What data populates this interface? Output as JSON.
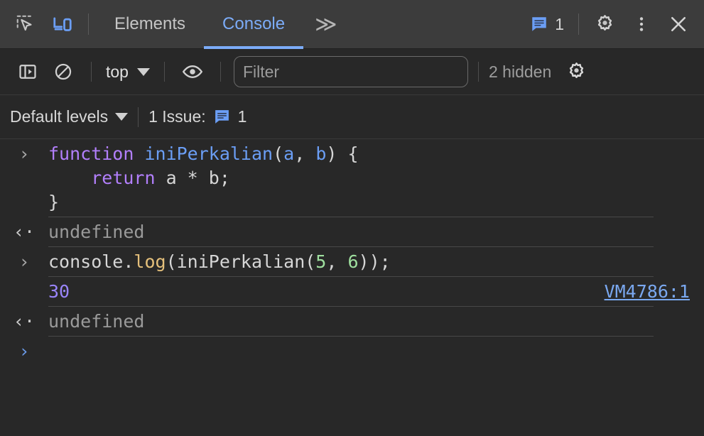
{
  "window": {
    "title": "Chrome DevTools - Console"
  },
  "colors": {
    "tabbar_bg": "#3c3c3c",
    "panel_bg": "#282828",
    "accent_blue": "#7cacf8",
    "keyword_purple": "#b27ffb",
    "function_blue": "#6b9ef5",
    "number_green": "#9fe09f",
    "method_yellow": "#e5c07b",
    "number_output_purple": "#9a85fb",
    "link_blue": "#7aa8f0",
    "muted_text": "#9a9a9a"
  },
  "tabbar": {
    "inspect_icon": "inspect-element-icon",
    "device_icon": "device-toolbar-icon",
    "tabs": [
      {
        "label": "Elements",
        "active": false
      },
      {
        "label": "Console",
        "active": true
      }
    ],
    "more_tabs_label": "≫",
    "issues": {
      "icon": "issue-message-icon",
      "count": "1"
    },
    "settings_icon": "gear-icon",
    "more_options_icon": "kebab-menu-icon",
    "close_icon": "close-icon"
  },
  "console_toolbar": {
    "sidebar_toggle_icon": "console-sidebar-icon",
    "clear_icon": "clear-console-icon",
    "context": {
      "label": "top",
      "caret": "chevron-down-icon"
    },
    "eye_icon": "live-expression-eye-icon",
    "filter": {
      "placeholder": "Filter",
      "value": ""
    },
    "hidden_label": "2 hidden",
    "settings_icon": "console-settings-gear-icon"
  },
  "console_toolbar2": {
    "levels_label": "Default levels",
    "levels_caret": "chevron-down-icon",
    "issue_text": "1 Issue:",
    "issue_icon": "issue-message-icon",
    "issue_count": "1"
  },
  "console_messages": [
    {
      "kind": "input",
      "gutter": "›",
      "tokens": [
        {
          "text": "function ",
          "cls": "kw"
        },
        {
          "text": "iniPerkalian",
          "cls": "fn"
        },
        {
          "text": "(",
          "cls": "pl"
        },
        {
          "text": "a",
          "cls": "fn"
        },
        {
          "text": ", ",
          "cls": "pl"
        },
        {
          "text": "b",
          "cls": "fn"
        },
        {
          "text": ") {\n    ",
          "cls": "pl"
        },
        {
          "text": "return",
          "cls": "kw"
        },
        {
          "text": " a * b;\n}",
          "cls": "pl"
        }
      ],
      "source": ""
    },
    {
      "kind": "output",
      "gutter": "‹·",
      "tokens": [
        {
          "text": "undefined",
          "cls": "muted"
        }
      ],
      "source": ""
    },
    {
      "kind": "input",
      "gutter": "›",
      "tokens": [
        {
          "text": "console.",
          "cls": "pl"
        },
        {
          "text": "log",
          "cls": "meth"
        },
        {
          "text": "(iniPerkalian(",
          "cls": "pl"
        },
        {
          "text": "5",
          "cls": "num"
        },
        {
          "text": ", ",
          "cls": "pl"
        },
        {
          "text": "6",
          "cls": "num"
        },
        {
          "text": "));",
          "cls": "pl"
        }
      ],
      "source": ""
    },
    {
      "kind": "result",
      "gutter": "",
      "tokens": [
        {
          "text": "30",
          "cls": "numout"
        }
      ],
      "source": "VM4786:1"
    },
    {
      "kind": "output",
      "gutter": "‹·",
      "tokens": [
        {
          "text": "undefined",
          "cls": "muted"
        }
      ],
      "source": ""
    }
  ],
  "prompt": {
    "glyph": "›",
    "value": ""
  }
}
